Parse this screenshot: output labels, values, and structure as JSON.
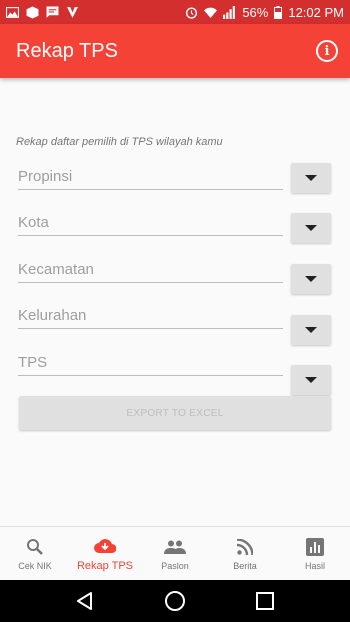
{
  "status_bar": {
    "battery": "56%",
    "time": "12:02 PM"
  },
  "app_bar": {
    "title": "Rekap TPS",
    "info_icon": "info-icon"
  },
  "main": {
    "subtitle": "Rekap daftar pemilih di TPS wilayah kamu",
    "fields": [
      {
        "placeholder": "Propinsi"
      },
      {
        "placeholder": "Kota"
      },
      {
        "placeholder": "Kecamatan"
      },
      {
        "placeholder": "Kelurahan"
      },
      {
        "placeholder": "TPS"
      }
    ],
    "export_label": "EXPORT TO EXCEL"
  },
  "bottom_nav": {
    "items": [
      {
        "label": "Cek NIK",
        "icon": "search-icon"
      },
      {
        "label": "Rekap TPS",
        "icon": "cloud-download-icon",
        "active": true
      },
      {
        "label": "Paslon",
        "icon": "people-icon"
      },
      {
        "label": "Berita",
        "icon": "rss-icon"
      },
      {
        "label": "Hasil",
        "icon": "bar-chart-icon"
      }
    ]
  },
  "colors": {
    "primary": "#f44336",
    "primary_dark": "#d32f2f"
  }
}
